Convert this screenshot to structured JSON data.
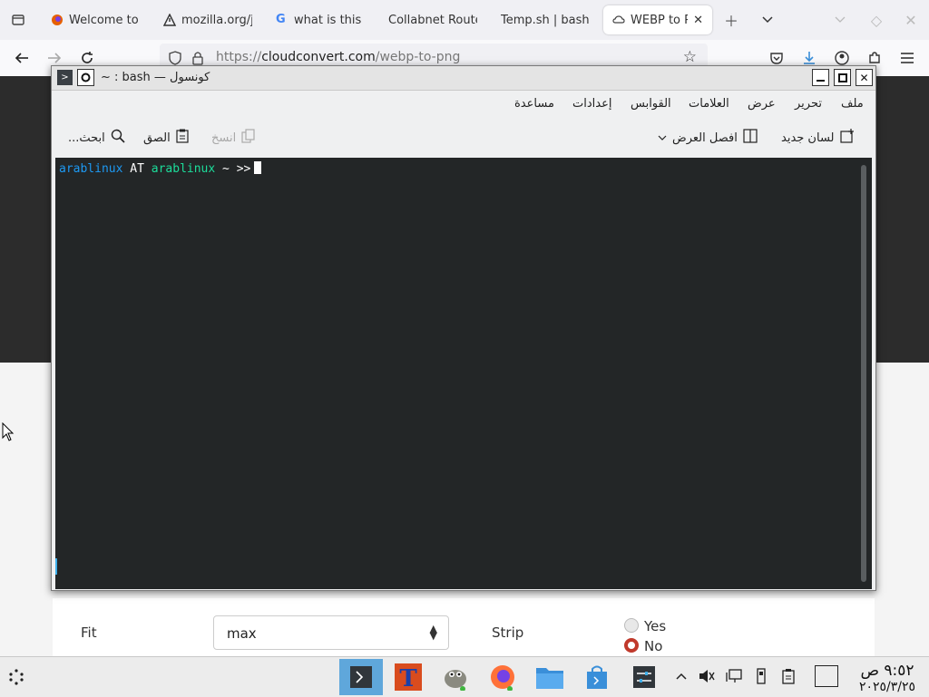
{
  "browser": {
    "tabs": [
      {
        "label": "Welcome to",
        "icon": "firefox-icon"
      },
      {
        "label": "mozilla.org/j",
        "icon": "warning-icon"
      },
      {
        "label": "what is this",
        "icon": "google-icon"
      },
      {
        "label": "Collabnet Route",
        "icon": ""
      },
      {
        "label": "Temp.sh | bash",
        "icon": ""
      },
      {
        "label": "WEBP to P",
        "icon": "cloud-icon",
        "active": true
      }
    ],
    "url_prefix": "https://",
    "url_domain": "cloudconvert.com",
    "url_path": "/webp-to-png"
  },
  "konsole": {
    "title": "~ : bash — كونسول",
    "menu": [
      "ملف",
      "تحرير",
      "عرض",
      "العلامات",
      "القوابس",
      "إعدادات",
      "مساعدة"
    ],
    "toolbar": {
      "new_tab": "لسان جديد",
      "split_view": "افصل العرض",
      "copy": "انسخ",
      "paste": "الصق",
      "search": "ابحث..."
    },
    "prompt": {
      "user": "arablinux",
      "at": "AT",
      "host": "arablinux",
      "path": "~",
      "symbol": ">>"
    },
    "colors": {
      "background": "#232627",
      "user": "#1d99f3",
      "host": "#1cdc9a"
    }
  },
  "site": {
    "fit_label": "Fit",
    "fit_value": "max",
    "strip_label": "Strip",
    "strip_options": [
      {
        "label": "Yes",
        "selected": false
      },
      {
        "label": "No",
        "selected": true
      }
    ]
  },
  "taskbar": {
    "time": "٩:٥٢ ص",
    "date": "٢٠٢٥/٣/٢٥"
  }
}
